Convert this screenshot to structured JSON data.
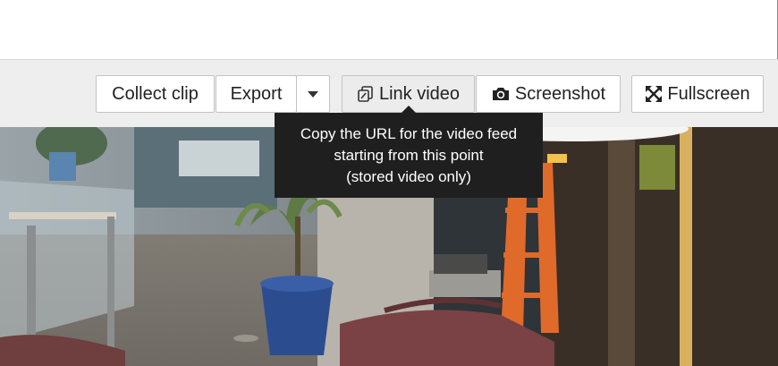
{
  "toolbar": {
    "collect_clip": "Collect clip",
    "export": "Export",
    "link_video": "Link video",
    "screenshot": "Screenshot",
    "fullscreen": "Fullscreen",
    "icons": {
      "export_dropdown": "caret-down-icon",
      "link_video": "copy-icon",
      "screenshot": "camera-icon",
      "fullscreen": "expand-arrows-icon"
    }
  },
  "tooltip": {
    "line1": "Copy the URL for the video feed",
    "line2": "starting from this point",
    "line3": "(stored video only)"
  }
}
